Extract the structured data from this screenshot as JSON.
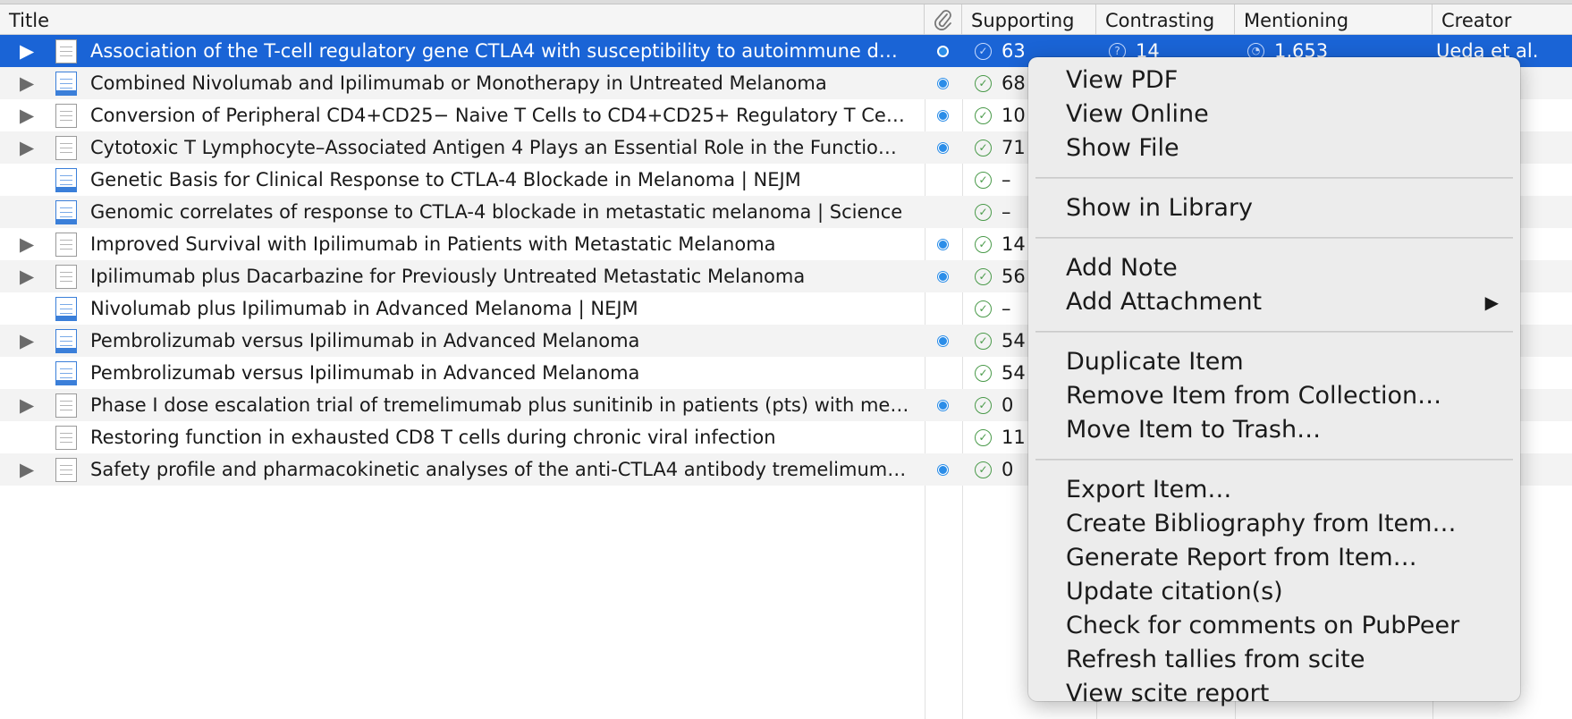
{
  "columns": {
    "title": "Title",
    "supporting": "Supporting",
    "contrasting": "Contrasting",
    "mentioning": "Mentioning",
    "creator": "Creator"
  },
  "rows": [
    {
      "title": "Association of the T-cell regulatory gene CTLA4 with susceptibility to autoimmune d…",
      "supporting": "63",
      "contrasting": "14",
      "mentioning": "1,653",
      "creator": "Ueda et al."
    },
    {
      "title": "Combined Nivolumab and Ipilimumab or Monotherapy in Untreated Melanoma",
      "supporting": "68",
      "creator": "al."
    },
    {
      "title": "Conversion of Peripheral CD4+CD25− Naive T Cells to CD4+CD25+ Regulatory T Ce…",
      "supporting": "10",
      "creator": "al."
    },
    {
      "title": "Cytotoxic T Lymphocyte–Associated Antigen 4 Plays an Essential Role in the Functio…",
      "supporting": "71",
      "creator": "al."
    },
    {
      "title": "Genetic Basis for Clinical Response to CTLA-4 Blockade in Melanoma | NEJM",
      "supporting": "–"
    },
    {
      "title": "Genomic correlates of response to CTLA-4 blockade in metastatic melanoma | Science",
      "supporting": "–"
    },
    {
      "title": "Improved Survival with Ipilimumab in Patients with Metastatic Melanoma",
      "supporting": "14",
      "creator": "al."
    },
    {
      "title": "Ipilimumab plus Dacarbazine for Previously Untreated Metastatic Melanoma",
      "supporting": "56",
      "creator": "t al."
    },
    {
      "title": "Nivolumab plus Ipilimumab in Advanced Melanoma | NEJM",
      "supporting": "–"
    },
    {
      "title": "Pembrolizumab versus Ipilimumab in Advanced Melanoma",
      "supporting": "54",
      "creator": "t al."
    },
    {
      "title": "Pembrolizumab versus Ipilimumab in Advanced Melanoma",
      "supporting": "54",
      "creator": "t al."
    },
    {
      "title": "Phase I dose escalation trial of tremelimumab plus sunitinib in patients (pts) with me…",
      "supporting": "0",
      "creator": "et al."
    },
    {
      "title": "Restoring function in exhausted CD8 T cells during chronic viral infection",
      "supporting": "11",
      "creator": "t al."
    },
    {
      "title": "Safety profile and pharmacokinetic analyses of the anti-CTLA4 antibody tremelimum…",
      "supporting": "0",
      "creator": "al."
    }
  ],
  "menu": {
    "view_pdf": "View PDF",
    "view_online": "View Online",
    "show_file": "Show File",
    "show_in_library": "Show in Library",
    "add_note": "Add Note",
    "add_attachment": "Add Attachment",
    "duplicate_item": "Duplicate Item",
    "remove_from_collection": "Remove Item from Collection…",
    "move_to_trash": "Move Item to Trash…",
    "export_item": "Export Item…",
    "create_bibliography": "Create Bibliography from Item…",
    "generate_report": "Generate Report from Item…",
    "update_citations": "Update citation(s)",
    "check_pubpeer": "Check for comments on PubPeer",
    "refresh_scite": "Refresh tallies from scite",
    "view_scite_report": "View scite report"
  }
}
